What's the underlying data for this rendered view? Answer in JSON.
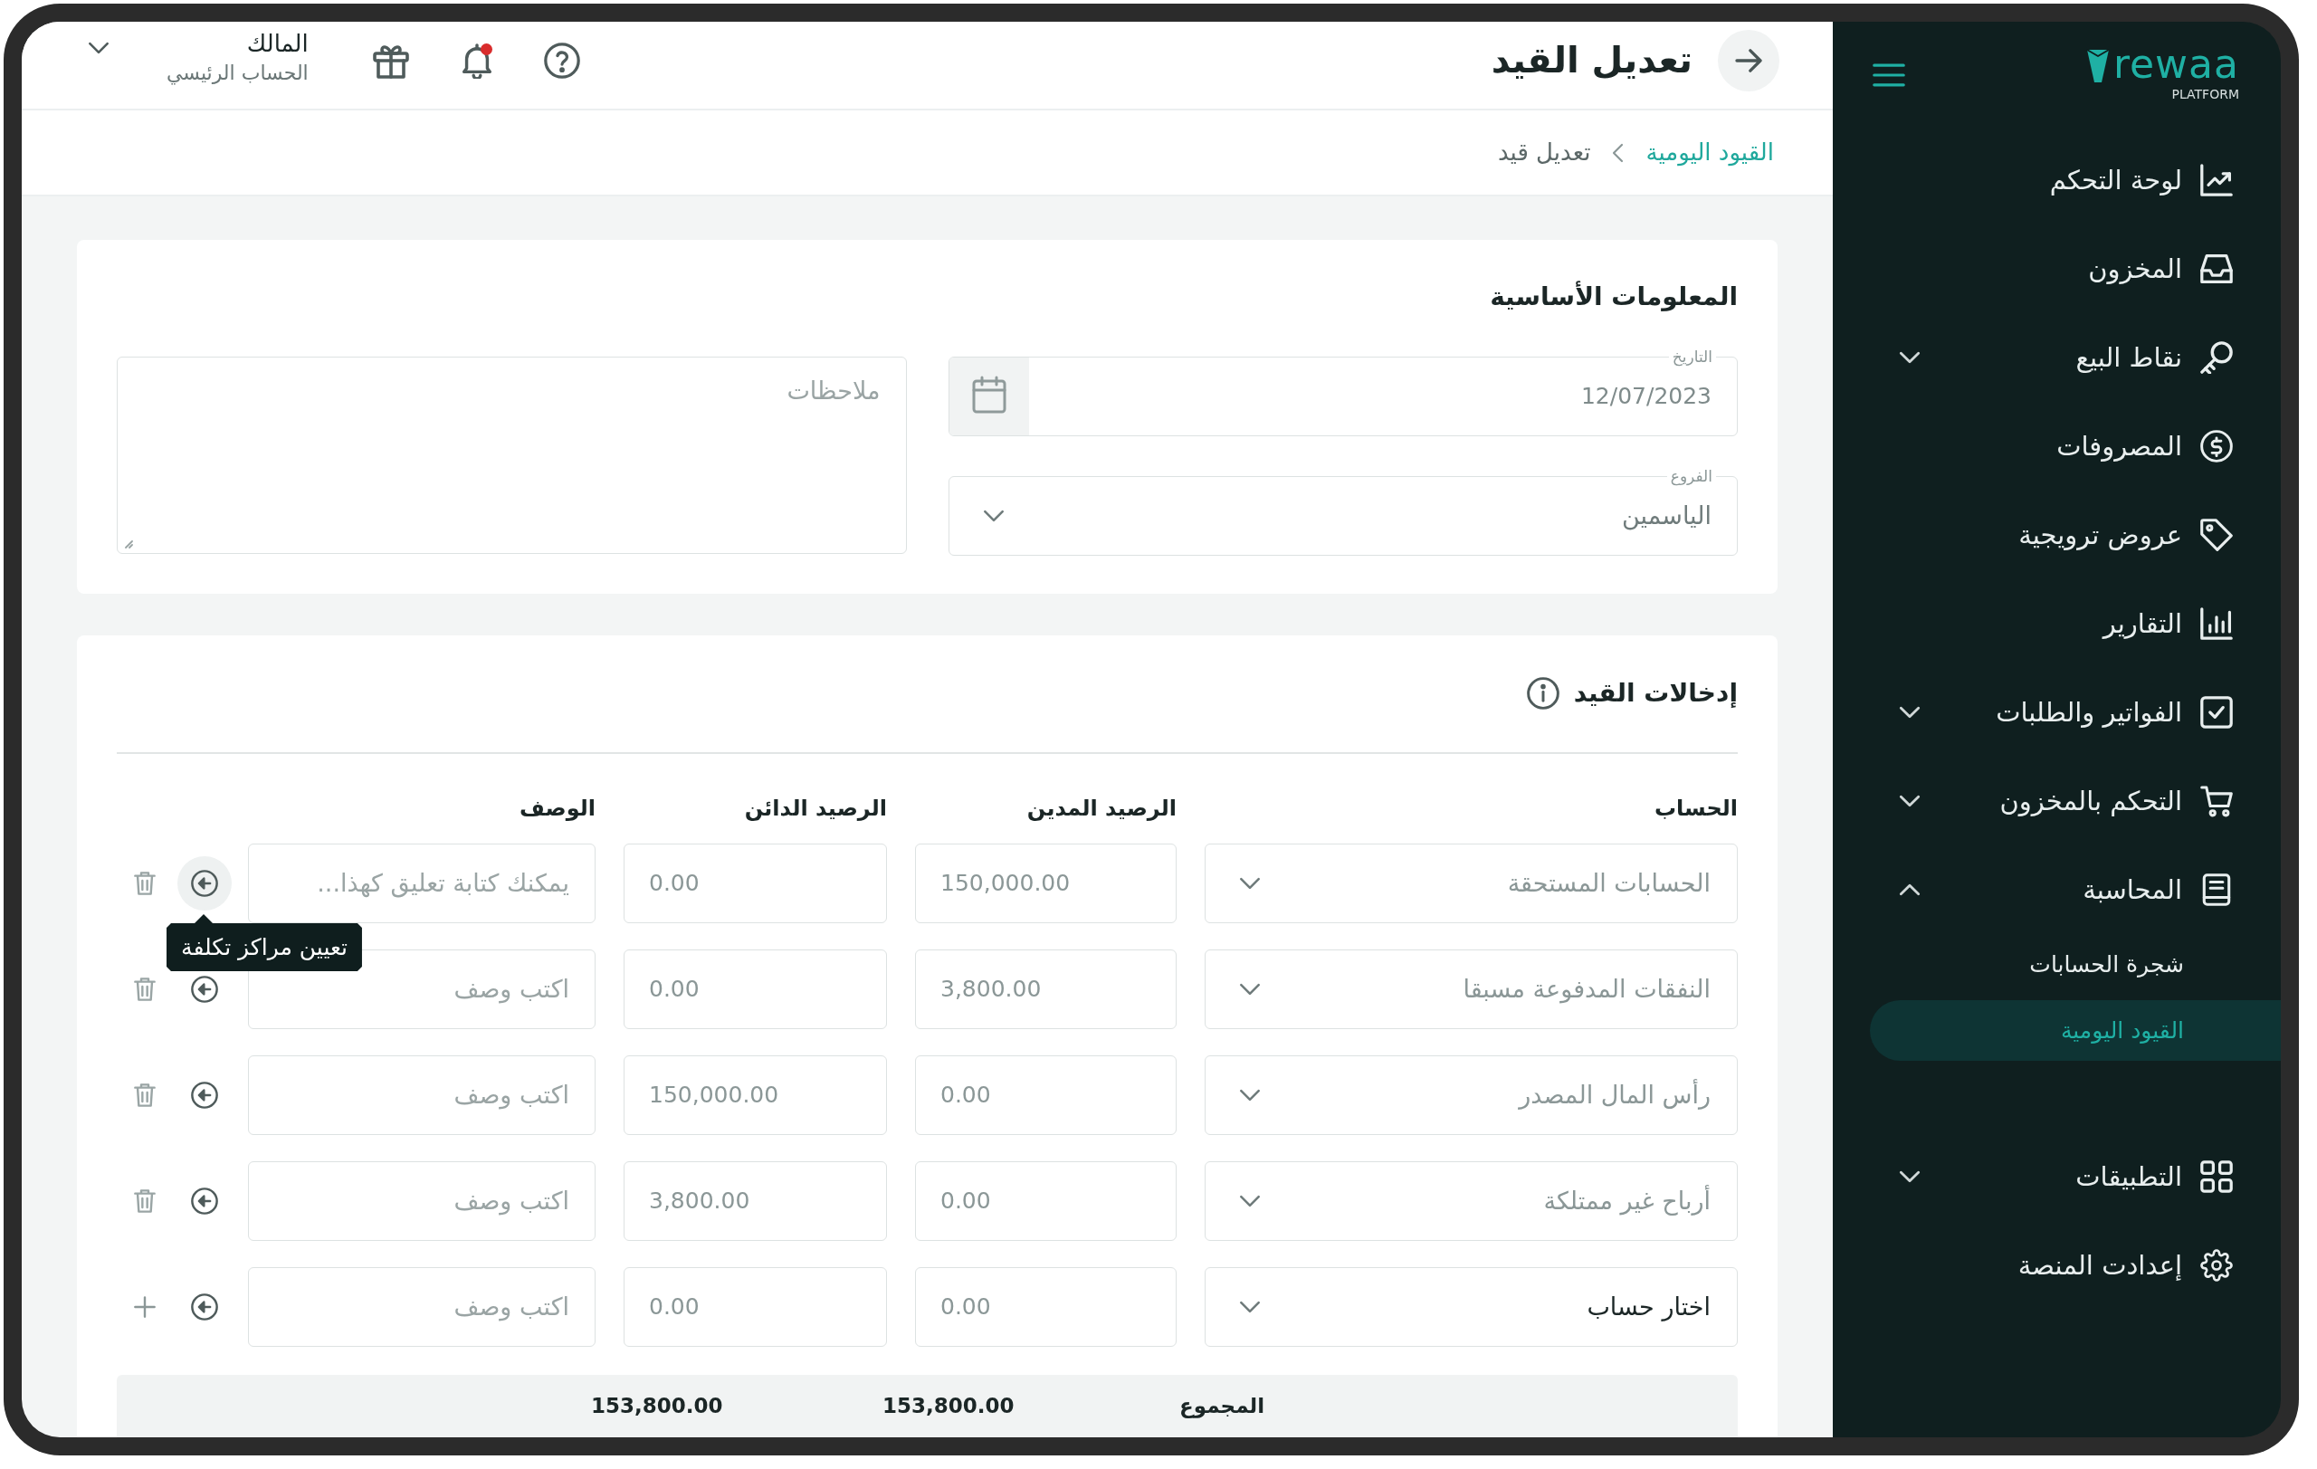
{
  "sidebar": {
    "logo": {
      "wordmark": "rewaa",
      "tagline": "PLATFORM"
    },
    "items": [
      {
        "kind": "link",
        "label": "لوحة التحكم",
        "selected": false
      },
      {
        "kind": "link",
        "label": "المخزون",
        "selected": false
      },
      {
        "kind": "group",
        "label": "نقاط البيع",
        "selected": false,
        "expanded": false
      },
      {
        "kind": "link",
        "label": "المصروفات",
        "selected": false
      },
      {
        "kind": "link",
        "label": "عروض ترويجية",
        "selected": false
      },
      {
        "kind": "link",
        "label": "التقارير",
        "selected": false
      },
      {
        "kind": "group",
        "label": "الفواتير والطلبات",
        "selected": false,
        "expanded": false
      },
      {
        "kind": "group",
        "label": "التحكم بالمخزون",
        "selected": false,
        "expanded": false
      },
      {
        "kind": "group",
        "label": "المحاسبة",
        "selected": false,
        "expanded": true,
        "children": [
          {
            "label": "شجرة الحسابات",
            "selected": false
          },
          {
            "label": "القيود اليومية",
            "selected": true
          }
        ]
      },
      {
        "kind": "group",
        "label": "التطبيقات",
        "selected": false,
        "expanded": false
      },
      {
        "kind": "link",
        "label": "إعدادت المنصة",
        "selected": false
      }
    ]
  },
  "header": {
    "title": "تعديل القيد",
    "notifications": {
      "unread": true
    },
    "user": {
      "name": "المالك",
      "account": "الحساب الرئيسي"
    }
  },
  "breadcrumb": [
    {
      "label": "القيود اليومية",
      "current": false
    },
    {
      "label": "تعديل قيد",
      "current": true
    }
  ],
  "basic_info": {
    "title": "المعلومات الأساسية",
    "date": {
      "label": "التاريخ",
      "value": "12/07/2023"
    },
    "branch": {
      "label": "الفروع",
      "value": "الياسمين"
    },
    "notes": {
      "placeholder": "ملاحظات"
    }
  },
  "entries": {
    "title": "إدخالات القيد",
    "columns": [
      "الحساب",
      "الرصيد المدين",
      "الرصيد الدائن",
      "الوصف"
    ],
    "rows": [
      {
        "kind": "entry",
        "account": "الحسابات المستحقة",
        "debit": "150,000.00",
        "credit": "0.00",
        "description": {
          "placeholder": "يمكنك كتابة تعليق كهذا..."
        },
        "tooltip": "تعيين مراكز تكلفة"
      },
      {
        "kind": "entry",
        "account": "النفقات المدفوعة مسبقا",
        "debit": "3,800.00",
        "credit": "0.00",
        "description": {
          "placeholder": "اكتب وصف"
        }
      },
      {
        "kind": "entry",
        "account": "رأس المال المصدر",
        "debit": "0.00",
        "credit": "150,000.00",
        "description": {
          "placeholder": "اكتب وصف"
        }
      },
      {
        "kind": "entry",
        "account": "أرباح غير ممتلكة",
        "debit": "0.00",
        "credit": "3,800.00",
        "description": {
          "placeholder": "اكتب وصف"
        }
      },
      {
        "kind": "new",
        "account": "اختار حساب",
        "debit": "0.00",
        "credit": "0.00",
        "description": {
          "placeholder": "اكتب وصف"
        }
      }
    ],
    "totals": {
      "label": "المجموع",
      "debit": "153,800.00",
      "credit": "153,800.00"
    }
  }
}
